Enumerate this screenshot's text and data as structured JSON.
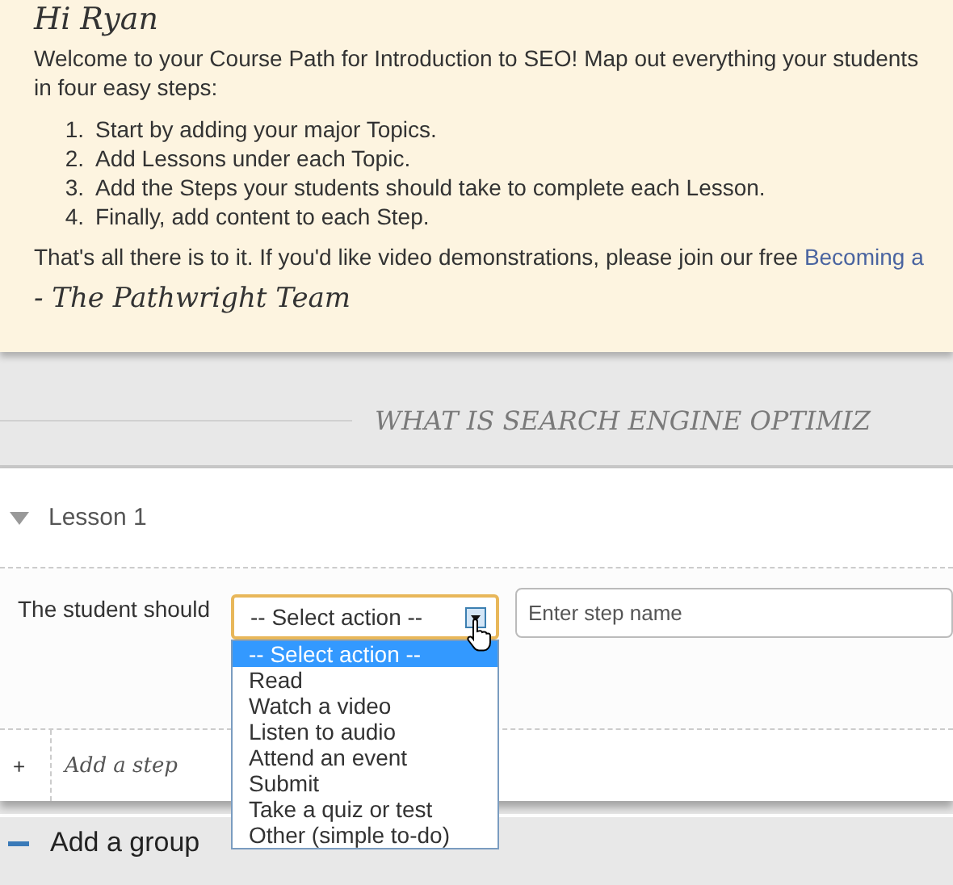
{
  "greeting": "Hi Ryan",
  "intro_lines": [
    "Welcome to your Course Path for Introduction to SEO! Map out everything your students",
    "in four easy steps:"
  ],
  "steps": [
    {
      "number": "1.",
      "text": "Start by adding your major Topics."
    },
    {
      "number": "2.",
      "text": "Add Lessons under each Topic."
    },
    {
      "number": "3.",
      "text": "Add the Steps your students should take to complete each Lesson."
    },
    {
      "number": "4.",
      "text": "Finally, add content to each Step."
    }
  ],
  "outro": {
    "text": "That's all there is to it. If you'd like video demonstrations, please join our free",
    "link": "Becoming a"
  },
  "signature": "- The Pathwright Team",
  "section_heading": "WHAT IS SEARCH ENGINE OPTIMIZ",
  "lesson": {
    "title": "Lesson 1",
    "expanded": true
  },
  "step_row": {
    "label": "The student should",
    "select": {
      "value": "-- Select action --",
      "open": true,
      "options": [
        {
          "label": "-- Select action --",
          "selected": true
        },
        {
          "label": "Read",
          "selected": false
        },
        {
          "label": "Watch a video",
          "selected": false
        },
        {
          "label": "Listen to audio",
          "selected": false
        },
        {
          "label": "Attend an event",
          "selected": false
        },
        {
          "label": "Submit",
          "selected": false
        },
        {
          "label": "Take a quiz or test",
          "selected": false
        },
        {
          "label": "Other (simple to-do)",
          "selected": false
        }
      ]
    },
    "name_field": {
      "placeholder": "Enter step name"
    }
  },
  "add_step": {
    "icon": "+",
    "label": "Add a step"
  },
  "add_group": {
    "label": "Add a group"
  }
}
